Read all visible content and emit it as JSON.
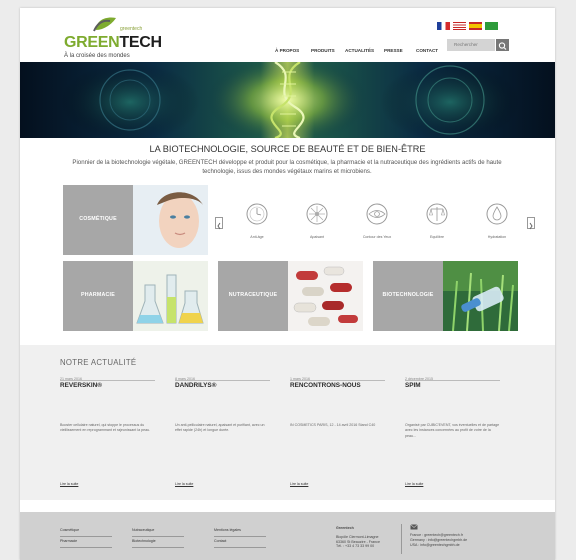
{
  "brand": {
    "small": "greentech",
    "name_part1": "GREEN",
    "name_part2": "TECH",
    "tagline": "À la croisée des mondes"
  },
  "nav": {
    "items": [
      "À PROPOS",
      "PRODUITS",
      "ACTUALITÉS",
      "PRESSE",
      "CONTACT"
    ]
  },
  "search": {
    "placeholder": "Rechercher"
  },
  "intro": {
    "title": "LA BIOTECHNOLOGIE, SOURCE DE BEAUTÉ ET DE BIEN-ÊTRE",
    "text": "Pionnier de la biotechnologie végétale, GREENTECH développe et produit pour la cosmétique, la pharmacie et la nutraceutique des ingrédients actifs de haute technologie, issus des mondes végétaux marins et microbiens."
  },
  "tiles": {
    "cosmetique": "COSMÉTIQUE",
    "pharmacie": "PHARMACIE",
    "nutraceutique": "NUTRACEUTIQUE",
    "biotechnologie": "BIOTECHNOLOGIE"
  },
  "carousel": {
    "items": [
      "Anti-âge",
      "Apaisant",
      "Contour des Yeux",
      "Equilibre",
      "Hydratation"
    ]
  },
  "news": {
    "title": "NOTRE ACTUALITÉ",
    "read_more": "Lire la suite",
    "items": [
      {
        "date": "21 mars 2016",
        "title": "REVERSKIN®",
        "body": "Booster cellulaire naturel, qui stoppe le processus du vieillissement en reprogrammant et rajeunissant la peau."
      },
      {
        "date": "8 mars 2016",
        "title": "DANDRILYS®",
        "body": "Un anti-pelliculaire naturel, apaisant et purifiant, avec un effet rapide (24h) et longue durée."
      },
      {
        "date": "1 mars 2016",
        "title": "RENCONTRONS-NOUS",
        "body": "IN COSMETICS PARIS, 12 - 14 avril 2016 Stand C40"
      },
      {
        "date": "2 décembre 2015",
        "title": "SPIM",
        "body": "Organisé par CUBIC'EVENT, vos éventuelles et de partage avec les instances concernées au profit de votre de la peau..."
      }
    ]
  },
  "footer": {
    "col1": [
      "Cosmétique",
      "Pharmacie"
    ],
    "col2": [
      "Nutraceutique",
      "Biotechnologie"
    ],
    "col3": [
      "Mentions légales",
      "Contact"
    ],
    "company": "Greentech",
    "address": [
      "Biopôle Clermont-Limagne",
      "63360 St Beauzire - France",
      "Tél. : +33 4 73 33 99 00"
    ],
    "contact_icon": "envelope-icon",
    "contacts": [
      "France : greentech@greentech.fr",
      "Germany : info@greentechgmbh.de",
      "USA : info@greentechgmbh.de"
    ]
  },
  "colors": {
    "accent": "#7eab2f",
    "tile_grey": "#a7a7a7",
    "news_bg": "#f0f0f0",
    "footer_bg": "#d0d0d0"
  }
}
